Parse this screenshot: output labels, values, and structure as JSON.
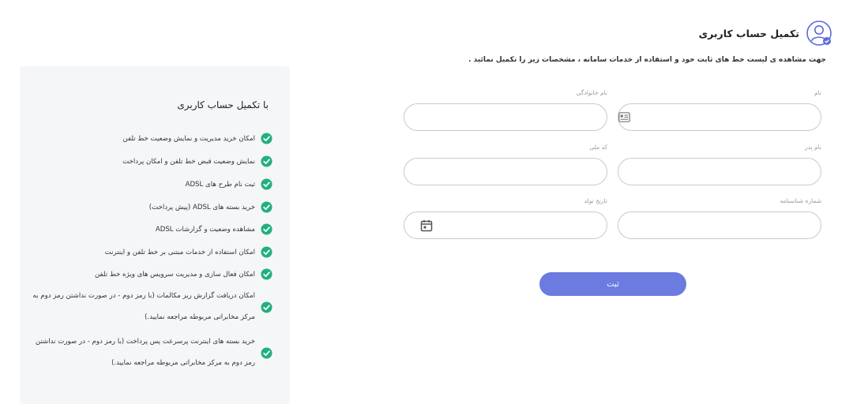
{
  "header": {
    "title": "تکمیل حساب کاربری",
    "subtitle": "جهت مشاهده ی لیست خط های ثابت خود و استفاده از خدمات سامانه ، مشخصات زیر را تکمیل نمائید ."
  },
  "form": {
    "first_name": {
      "label": "نام",
      "value": ""
    },
    "last_name": {
      "label": "نام خانوادگی",
      "value": ""
    },
    "father_name": {
      "label": "نام پدر",
      "value": ""
    },
    "national_code": {
      "label": "کد ملی",
      "value": ""
    },
    "id_number": {
      "label": "شماره شناسنامه",
      "value": ""
    },
    "birth_date": {
      "label": "تاریخ تولد",
      "value": ""
    },
    "submit_label": "ثبت"
  },
  "panel": {
    "title": "با تکمیل حساب کاربری",
    "items": [
      "امکان خرید مدیریت و نمایش وضعیت خط تلفن",
      "نمایش وضعیت قبض خط تلفن و امکان پرداخت",
      "ثبت نام طرح های ADSL",
      "خرید بسته های ADSL (پیش پرداخت)",
      "مشاهده وضعیت و گزارشات ADSL",
      "امکان استفاده از خدمات مبتنی بر خط تلفن و اینترنت",
      "امکان فعال سازی و مدیریت سرویس های ویژه خط تلفن",
      "امکان دریافت گزارش ریز مکالمات (با رمز دوم - در صورت نداشتن رمز دوم به مرکز مخابراتی مربوطه مراجعه نمایید.)",
      "خرید بسته های اینترنت پرسرعت پس پرداخت (با رمز دوم - در صورت نداشتن رمز دوم به مرکز مخابراتی مربوطه مراجعه نمایید.)"
    ]
  },
  "colors": {
    "accent": "#6b7be0",
    "check": "#22b07d",
    "panel_bg": "#f5f6f8",
    "border": "#c9c9c9"
  },
  "icons": {
    "avatar": "user-avatar-icon",
    "id_card": "id-card-icon",
    "calendar": "calendar-icon",
    "check": "check-circle-icon"
  }
}
